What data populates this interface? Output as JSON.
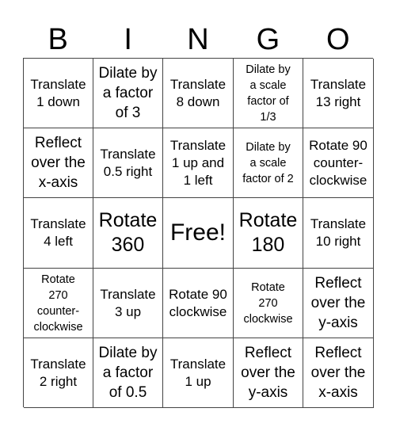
{
  "header": {
    "letters": [
      "B",
      "I",
      "N",
      "G",
      "O"
    ]
  },
  "cells": [
    [
      "Translate\n1 down",
      "Dilate by\na factor\nof 3",
      "Translate\n8 down",
      "Dilate by\na scale\nfactor of\n1/3",
      "Translate\n13 right"
    ],
    [
      "Reflect\nover the\nx-axis",
      "Translate\n0.5 right",
      "Translate\n1 up and\n1 left",
      "Dilate by\na scale\nfactor of 2",
      "Rotate 90\ncounter-\nclockwise"
    ],
    [
      "Translate\n4 left",
      "Rotate\n360",
      "Free!",
      "Rotate\n180",
      "Translate\n10 right"
    ],
    [
      "Rotate\n270\ncounter-\nclockwise",
      "Translate\n3 up",
      "Rotate 90\nclockwise",
      "Rotate\n270\nclockwise",
      "Reflect\nover the\ny-axis"
    ],
    [
      "Translate\n2 right",
      "Dilate by\na factor\nof 0.5",
      "Translate\n1 up",
      "Reflect\nover the\ny-axis",
      "Reflect\nover the\nx-axis"
    ]
  ]
}
